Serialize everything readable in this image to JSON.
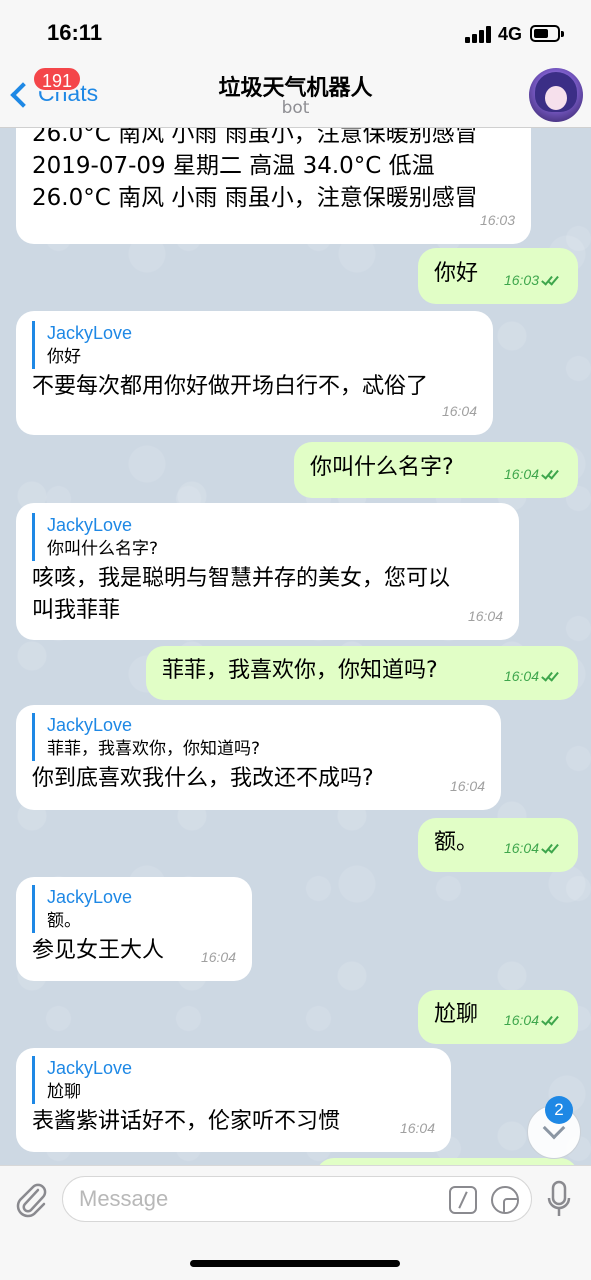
{
  "status_bar": {
    "time": "16:11",
    "network": "4G"
  },
  "nav": {
    "back_label": "Chats",
    "unread_count": "191",
    "title": "垃圾天气机器人",
    "subtitle": "bot"
  },
  "messages": [
    {
      "lines": [
        "26.0°C 南风 小雨 雨虽小，注意保暖别感冒",
        "2019-07-09 星期二 高温 34.0°C 低温",
        "26.0°C 南风 小雨 雨虽小，注意保暖别感冒"
      ],
      "time": "16:03"
    },
    {
      "text": "你好",
      "time": "16:03"
    },
    {
      "reply_name": "JackyLove",
      "reply_text": "你好",
      "text": "不要每次都用你好做开场白行不，忒俗了",
      "time": "16:04"
    },
    {
      "text": "你叫什么名字?",
      "time": "16:04"
    },
    {
      "reply_name": "JackyLove",
      "reply_text": "你叫什么名字?",
      "lines": [
        "咳咳，我是聪明与智慧并存的美女，您可以",
        "叫我菲菲"
      ],
      "time": "16:04"
    },
    {
      "text": "菲菲，我喜欢你，你知道吗?",
      "time": "16:04"
    },
    {
      "reply_name": "JackyLove",
      "reply_text": "菲菲，我喜欢你，你知道吗?",
      "text": "你到底喜欢我什么，我改还不成吗?",
      "time": "16:04"
    },
    {
      "text": "额。",
      "time": "16:04"
    },
    {
      "reply_name": "JackyLove",
      "reply_text": "额。",
      "text": "参见女王大人",
      "time": "16:04"
    },
    {
      "text": "尬聊",
      "time": "16:04"
    },
    {
      "reply_name": "JackyLove",
      "reply_text": "尬聊",
      "text": "表酱紫讲话好不，伦家听不习惯",
      "time": "16:04"
    }
  ],
  "scroll_badge": "2",
  "input": {
    "placeholder": "Message"
  },
  "colors": {
    "accent": "#1e88e5",
    "outgoing_bubble": "#e1fec6",
    "incoming_bubble": "#ffffff",
    "badge": "#f4464a"
  }
}
